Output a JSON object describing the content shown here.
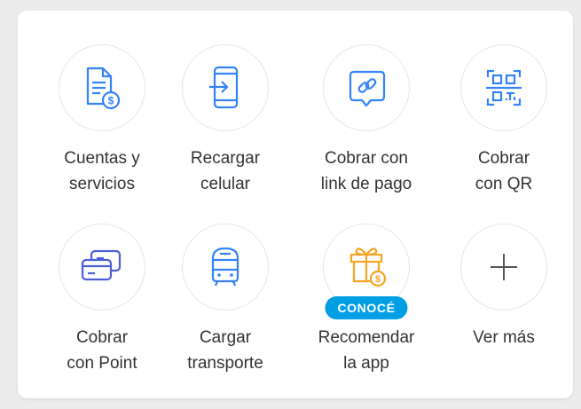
{
  "colors": {
    "accent": "#009ee3",
    "icon_blue": "#3483fa",
    "icon_indigo": "#4b5fd6",
    "icon_gift": "#f5a623",
    "text": "#333333"
  },
  "actions": [
    {
      "icon": "bill-icon",
      "line1": "Cuentas y",
      "line2": "servicios"
    },
    {
      "icon": "phone-recharge-icon",
      "line1": "Recargar",
      "line2": "celular"
    },
    {
      "icon": "link-chat-icon",
      "line1": "Cobrar con",
      "line2": "link de pago"
    },
    {
      "icon": "qr-code-icon",
      "line1": "Cobrar",
      "line2": "con QR"
    },
    {
      "icon": "card-reader-icon",
      "line1": "Cobrar",
      "line2": "con Point"
    },
    {
      "icon": "bus-icon",
      "line1": "Cargar",
      "line2": "transporte"
    },
    {
      "icon": "gift-icon",
      "line1": "Recomendar",
      "line2": "la app",
      "badge": "CONOCÉ"
    },
    {
      "icon": "plus-icon",
      "line1": "Ver más",
      "line2": ""
    }
  ]
}
